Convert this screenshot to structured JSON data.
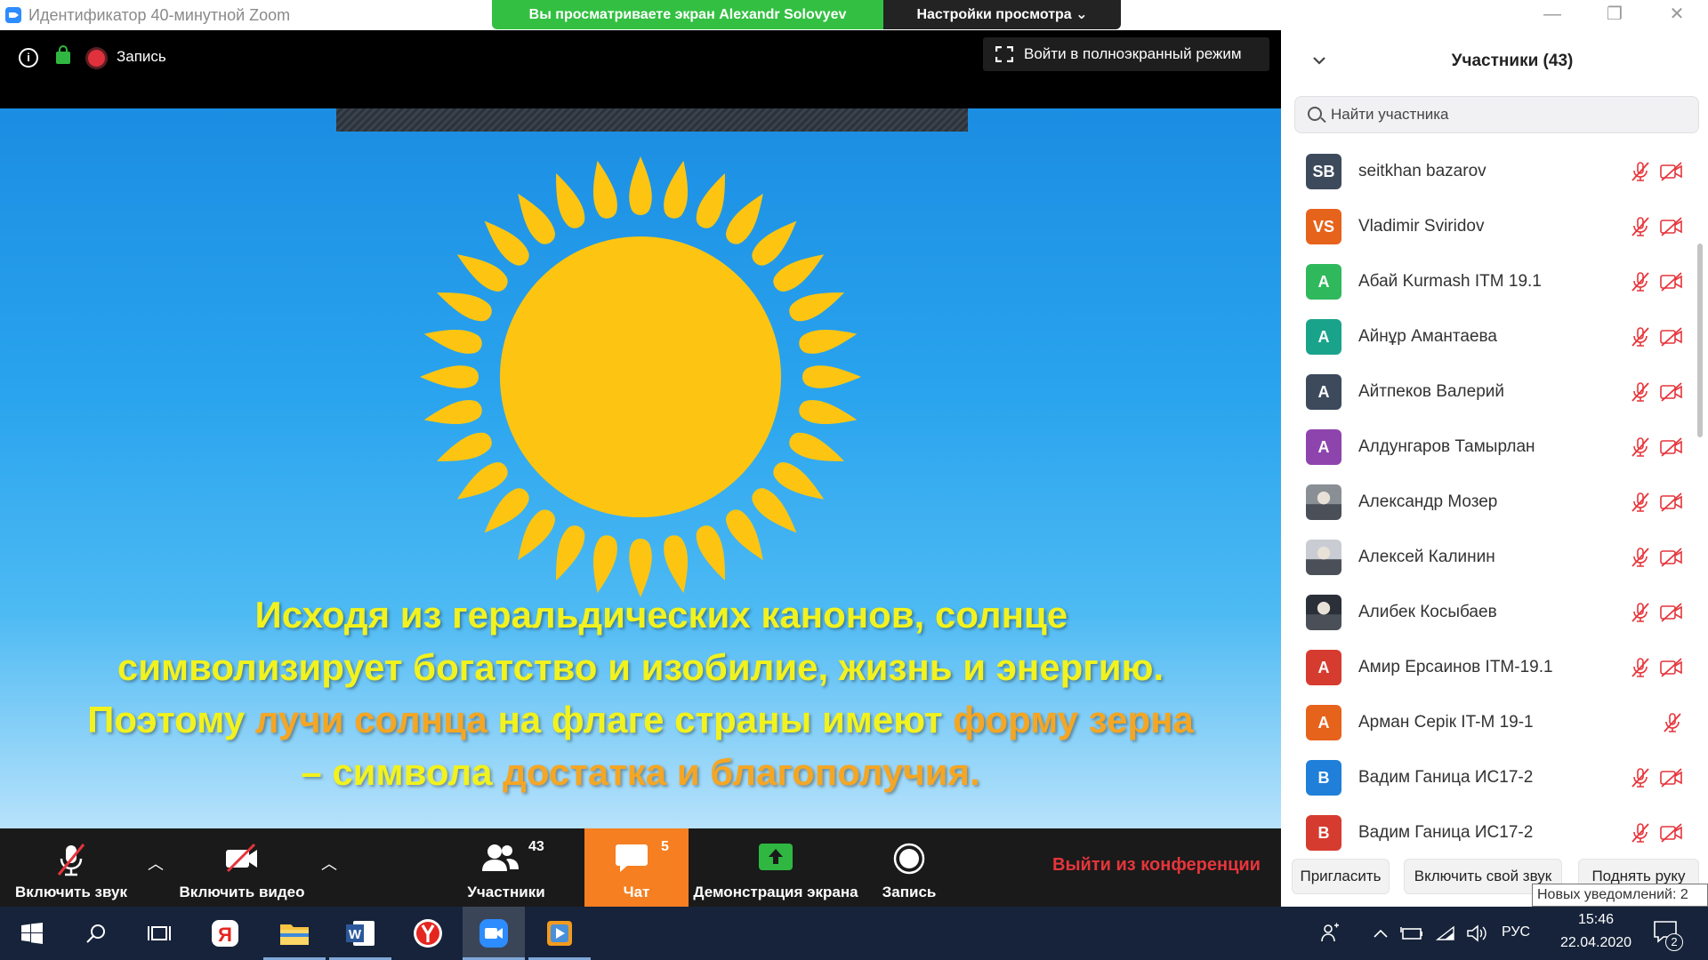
{
  "window": {
    "title": "Идентификатор 40-минутной Zoom",
    "share_banner": "Вы просматриваете экран Alexandr Solovyev",
    "view_options": "Настройки просмотра ⌄"
  },
  "meeting_bar": {
    "record_label": "Запись",
    "fullscreen_label": "Войти в полноэкранный режим"
  },
  "slide": {
    "line1": "Исходя из геральдических канонов, солнце",
    "line2": "символизирует богатство и изобилие, жизнь и энергию.",
    "line3_a": "Поэтому ",
    "line3_b": "лучи солнца",
    "line3_c": " на флаге страны имеют ",
    "line3_d": "форму зерна",
    "line4_a": "– символа ",
    "line4_b": "достатка и благополучия."
  },
  "toolbar": {
    "audio_label": "Включить звук",
    "video_label": "Включить видео",
    "participants_label": "Участники",
    "participants_count": "43",
    "chat_label": "Чат",
    "chat_count": "5",
    "share_label": "Демонстрация экрана",
    "record_label": "Запись",
    "leave_label": "Выйти из конференции"
  },
  "panel": {
    "title": "Участники (43)",
    "search_placeholder": "Найти участника",
    "participants": [
      {
        "initials": "SB",
        "name": "seitkhan bazarov",
        "color": "#3d4a5c"
      },
      {
        "initials": "VS",
        "name": "Vladimir Sviridov",
        "color": "#e6631c"
      },
      {
        "initials": "A",
        "name": "Абай Kurmash ITM 19.1",
        "color": "#2fb85c"
      },
      {
        "initials": "A",
        "name": "Айнұр Амантаева",
        "color": "#1aa38b"
      },
      {
        "initials": "A",
        "name": "Айтпеков Валерий",
        "color": "#3d4a5c"
      },
      {
        "initials": "A",
        "name": "Алдунгаров Тамырлан",
        "color": "#8e44ad"
      },
      {
        "initials": "",
        "name": "Александр Мозер",
        "color": "#8a8f96"
      },
      {
        "initials": "",
        "name": "Алексей Калинин",
        "color": "#c9ccd3"
      },
      {
        "initials": "",
        "name": "Алибек Косыбаев",
        "color": "#2a2f38"
      },
      {
        "initials": "A",
        "name": "Амир Ерсаинов ITM-19.1",
        "color": "#d63b2f"
      },
      {
        "initials": "A",
        "name": "Арман Серік IT-M 19-1",
        "color": "#e6631c"
      },
      {
        "initials": "B",
        "name": "Вадим Ганица ИС17-2",
        "color": "#1f7fd9"
      },
      {
        "initials": "B",
        "name": "Вадим Ганица ИС17-2",
        "color": "#d63b2f"
      }
    ],
    "invite_label": "Пригласить",
    "unmute_self_label": "Включить свой звук",
    "raise_hand_label": "Поднять руку",
    "tooltip": "Новых уведомлений: 2"
  },
  "taskbar": {
    "lang": "РУС",
    "time": "15:46",
    "date": "22.04.2020",
    "notif_count": "2"
  }
}
